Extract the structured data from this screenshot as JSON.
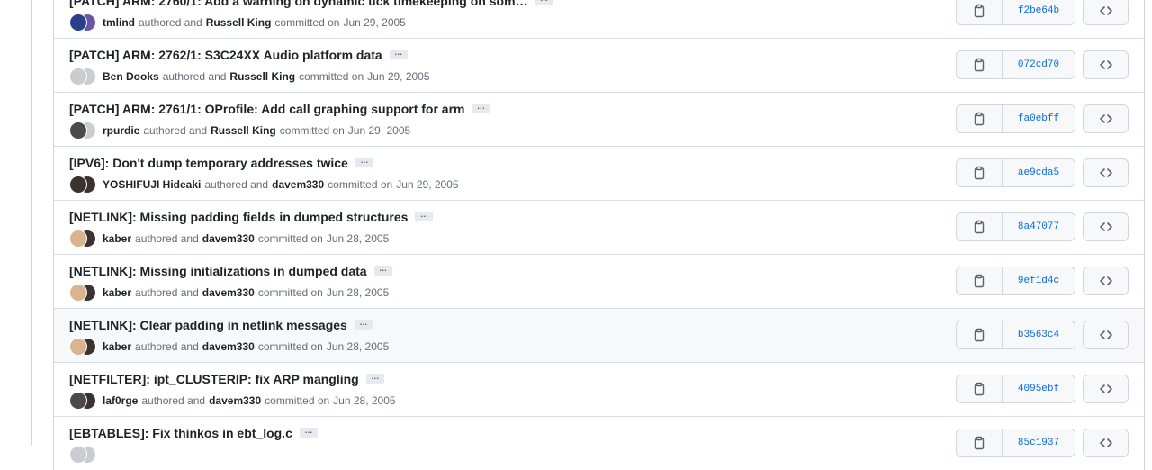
{
  "commits": [
    {
      "title": "[PATCH] ARM: 2760/1: Add a warning on dynamic tick timekeeping on som…",
      "avatars": [
        "blue",
        "purple"
      ],
      "author": "tmlind",
      "committer": "Russell King",
      "date": "Jun 29, 2005",
      "sha": "f2be64b",
      "highlighted": false
    },
    {
      "title": "[PATCH] ARM: 2762/1: S3C24XX Audio platform data",
      "avatars": [
        "gray",
        "gray"
      ],
      "author": "Ben Dooks",
      "committer": "Russell King",
      "date": "Jun 29, 2005",
      "sha": "072cd70",
      "highlighted": false
    },
    {
      "title": "[PATCH] ARM: 2761/1: OProfile: Add call graphing support for arm",
      "avatars": [
        "bw",
        "gray"
      ],
      "author": "rpurdie",
      "committer": "Russell King",
      "date": "Jun 29, 2005",
      "sha": "fa0ebff",
      "highlighted": false
    },
    {
      "title": "[IPV6]: Don't dump temporary addresses twice",
      "avatars": [
        "dark",
        "dark"
      ],
      "author": "YOSHIFUJI Hideaki",
      "committer": "davem330",
      "date": "Jun 29, 2005",
      "sha": "ae9cda5",
      "highlighted": false
    },
    {
      "title": "[NETLINK]: Missing padding fields in dumped structures",
      "avatars": [
        "tan",
        "dark"
      ],
      "author": "kaber",
      "committer": "davem330",
      "date": "Jun 28, 2005",
      "sha": "8a47077",
      "highlighted": false
    },
    {
      "title": "[NETLINK]: Missing initializations in dumped data",
      "avatars": [
        "tan",
        "dark"
      ],
      "author": "kaber",
      "committer": "davem330",
      "date": "Jun 28, 2005",
      "sha": "9ef1d4c",
      "highlighted": false
    },
    {
      "title": "[NETLINK]: Clear padding in netlink messages",
      "avatars": [
        "tan",
        "dark"
      ],
      "author": "kaber",
      "committer": "davem330",
      "date": "Jun 28, 2005",
      "sha": "b3563c4",
      "highlighted": true
    },
    {
      "title": "[NETFILTER]: ipt_CLUSTERIP: fix ARP mangling",
      "avatars": [
        "bw",
        "dark"
      ],
      "author": "laf0rge",
      "committer": "davem330",
      "date": "Jun 28, 2005",
      "sha": "4095ebf",
      "highlighted": false
    },
    {
      "title": "[EBTABLES]: Fix thinkos in ebt_log.c",
      "avatars": [
        "gray",
        "gray"
      ],
      "author": "",
      "committer": "",
      "date": "",
      "sha": "85c1937",
      "highlighted": false
    }
  ],
  "labels": {
    "authored_and": "authored and",
    "committed_on": "committed on",
    "ellipsis": "…"
  },
  "icons": {
    "copy": "clipboard-icon",
    "browse": "code-icon",
    "more": "ellipsis-icon"
  },
  "avatar_colors": {
    "blue": "#2b3f8f",
    "purple": "#6a55a8",
    "gray": "#c9ccd0",
    "bw": "#4a4a4a",
    "dark": "#3a3330",
    "tan": "#d9b48f"
  },
  "colors": {
    "sha": "#0969da",
    "border": "#d0d7de",
    "muted": "#656d76",
    "highlight": "#f6f8fa"
  }
}
